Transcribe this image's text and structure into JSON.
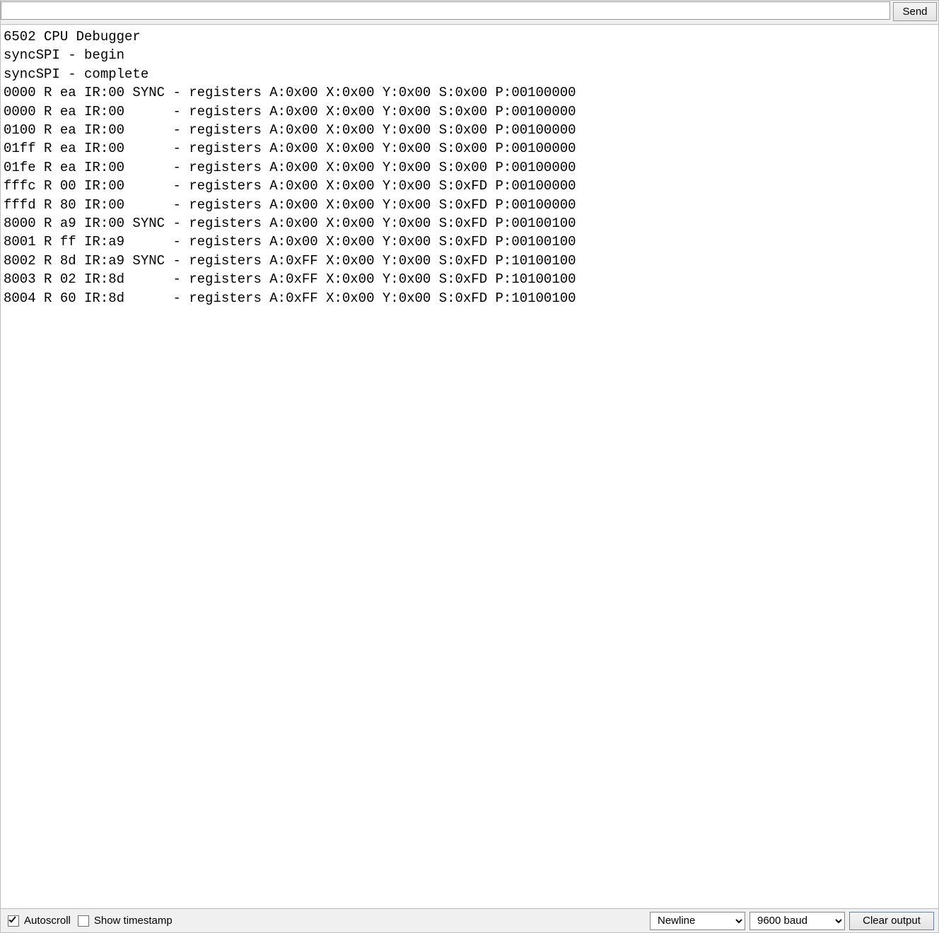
{
  "top": {
    "send_label": "Send",
    "input_value": ""
  },
  "console_lines": [
    "6502 CPU Debugger",
    "syncSPI - begin",
    "syncSPI - complete",
    "0000 R ea IR:00 SYNC - registers A:0x00 X:0x00 Y:0x00 S:0x00 P:00100000",
    "0000 R ea IR:00      - registers A:0x00 X:0x00 Y:0x00 S:0x00 P:00100000",
    "0100 R ea IR:00      - registers A:0x00 X:0x00 Y:0x00 S:0x00 P:00100000",
    "01ff R ea IR:00      - registers A:0x00 X:0x00 Y:0x00 S:0x00 P:00100000",
    "01fe R ea IR:00      - registers A:0x00 X:0x00 Y:0x00 S:0x00 P:00100000",
    "fffc R 00 IR:00      - registers A:0x00 X:0x00 Y:0x00 S:0xFD P:00100000",
    "fffd R 80 IR:00      - registers A:0x00 X:0x00 Y:0x00 S:0xFD P:00100000",
    "8000 R a9 IR:00 SYNC - registers A:0x00 X:0x00 Y:0x00 S:0xFD P:00100100",
    "8001 R ff IR:a9      - registers A:0x00 X:0x00 Y:0x00 S:0xFD P:00100100",
    "8002 R 8d IR:a9 SYNC - registers A:0xFF X:0x00 Y:0x00 S:0xFD P:10100100",
    "8003 R 02 IR:8d      - registers A:0xFF X:0x00 Y:0x00 S:0xFD P:10100100",
    "8004 R 60 IR:8d      - registers A:0xFF X:0x00 Y:0x00 S:0xFD P:10100100"
  ],
  "bottom": {
    "autoscroll_label": "Autoscroll",
    "autoscroll_checked": true,
    "timestamp_label": "Show timestamp",
    "timestamp_checked": false,
    "line_ending_value": "Newline",
    "baud_value": "9600 baud",
    "clear_label": "Clear output"
  }
}
